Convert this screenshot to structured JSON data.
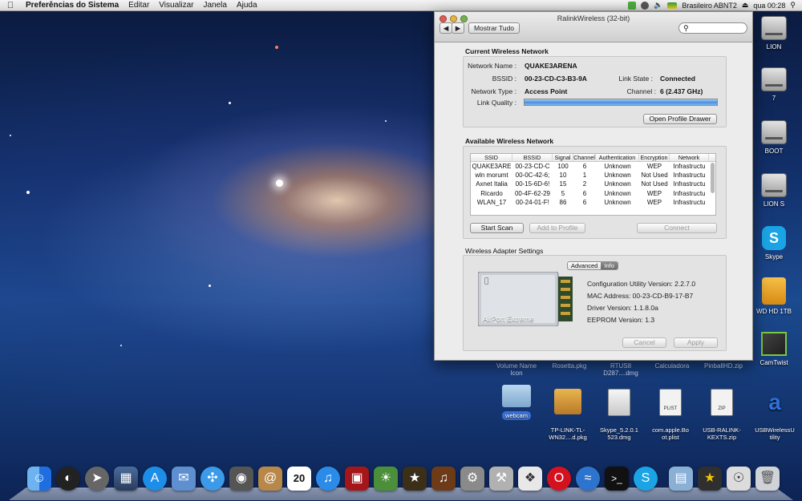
{
  "menubar": {
    "app_name": "Preferências do Sistema",
    "menus": [
      "Editar",
      "Visualizar",
      "Janela",
      "Ajuda"
    ],
    "keyboard_layout": "Brasileiro ABNT2",
    "clock": "qua 00:28"
  },
  "window": {
    "title": "RalinkWireless (32-bit)",
    "show_all_label": "Mostrar Tudo",
    "search_value": "",
    "current": {
      "section_title": "Current Wireless Network",
      "network_name_label": "Network Name :",
      "network_name": "QUAKE3ARENA",
      "bssid_label": "BSSID :",
      "bssid": "00-23-CD-C3-B3-9A",
      "link_state_label": "Link State :",
      "link_state": "Connected",
      "network_type_label": "Network Type :",
      "network_type": "Access Point",
      "channel_label": "Channel :",
      "channel": "6 (2.437 GHz)",
      "link_quality_label": "Link Quality :",
      "link_quality": 1.0,
      "open_profile_label": "Open Profile Drawer"
    },
    "available": {
      "section_title": "Available Wireless Network",
      "columns": [
        "SSID",
        "BSSID",
        "Signal",
        "Channel",
        "Authentication",
        "Encryption",
        "Network"
      ],
      "rows": [
        [
          "QUAKE3ARE",
          "00-23-CD-C",
          "100",
          "6",
          "Unknown",
          "WEP",
          "Infrastructu"
        ],
        [
          "wln morumt",
          "00-0C-42-6;",
          "10",
          "1",
          "Unknown",
          "Not Used",
          "Infrastructu"
        ],
        [
          "Axnet Italia",
          "00-15-6D-6!",
          "15",
          "2",
          "Unknown",
          "Not Used",
          "Infrastructu"
        ],
        [
          "Ricardo",
          "00-4F-62-29",
          "5",
          "6",
          "Unknown",
          "WEP",
          "Infrastructu"
        ],
        [
          "WLAN_17",
          "00-24-01-F!",
          "86",
          "6",
          "Unknown",
          "WEP",
          "Infrastructu"
        ]
      ],
      "start_scan_label": "Start Scan",
      "add_profile_label": "Add to Profile",
      "connect_label": "Connect"
    },
    "adapter": {
      "section_title": "Wireless Adapter Settings",
      "tab_advanced": "Advanced",
      "tab_info": "Info",
      "card_label": "AirPort Extreme",
      "config_version": "Configuration Utility Version:  2.2.7.0",
      "mac_address": "MAC Address:   00-23-CD-B9-17-B7",
      "driver_version": "Driver Version:   1.1.8.0a",
      "eeprom_version": "EEPROM Version:   1.3",
      "cancel_label": "Cancel",
      "apply_label": "Apply"
    }
  },
  "desktop": {
    "drives": [
      "LION",
      "7",
      "BOOT",
      "LION S",
      "Skype",
      "WD HD 1TB",
      "CamTwist"
    ],
    "hidden_labels": [
      "Volume Name\nIcon",
      "Rosetta.pkg",
      "RTUS8\nD287....dmg",
      "Calculadora",
      "PinballHD.zip"
    ],
    "files": [
      {
        "name": "webcam"
      },
      {
        "name": "TP-LINK-TL-\nWN32....d.pkg"
      },
      {
        "name": "Skype_5.2.0.1\n523.dmg"
      },
      {
        "name": "com.apple.Bo\not.plist",
        "badge": "PLIST"
      },
      {
        "name": "USB-RALINK-\nKEXTS.zip",
        "badge": "ZIP"
      },
      {
        "name": "USBWirelessU\ntility"
      }
    ]
  },
  "dock": {
    "apps": [
      "finder",
      "dashboard",
      "launchpad",
      "mission-control",
      "app-store",
      "mail",
      "safari",
      "facetime",
      "address-book",
      "calendar",
      "itunes",
      "photo-booth",
      "iphoto",
      "imovie",
      "garageband",
      "system-preferences",
      "utility",
      "preview",
      "opera",
      "wireless",
      "terminal",
      "skype",
      "folder",
      "game",
      "disk-utility",
      "trash"
    ],
    "calendar_day": "20"
  }
}
